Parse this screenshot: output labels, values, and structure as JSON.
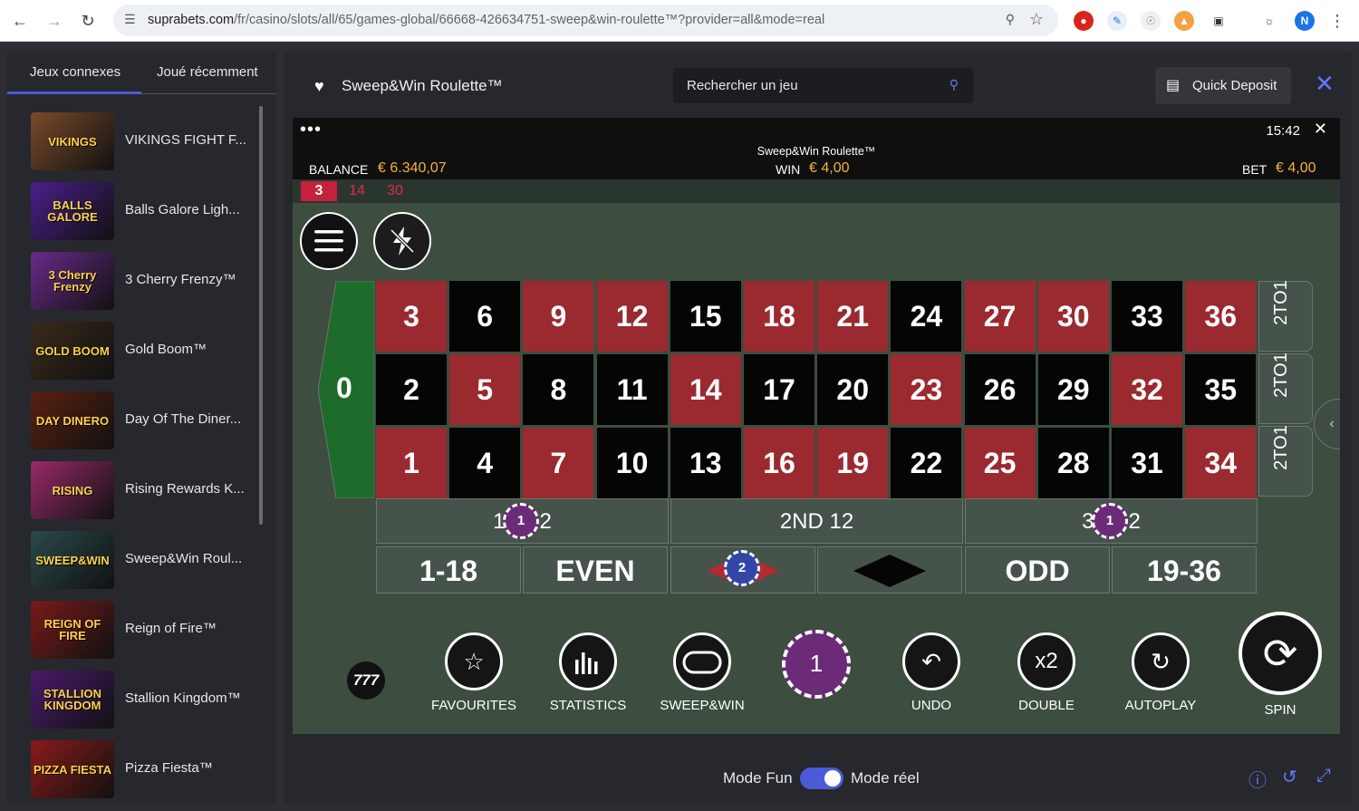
{
  "browser": {
    "url_host": "suprabets.com",
    "url_path": "/fr/casino/slots/all/65/games-global/66668-426634751-sweep&win-roulette™?provider=all&mode=real",
    "profile_initial": "N"
  },
  "sidebar": {
    "tabs": [
      "Jeux connexes",
      "Joué récemment"
    ],
    "games": [
      {
        "name": "VIKINGS FIGHT F...",
        "thumb": "VIKINGS",
        "color": "#7a4a2a"
      },
      {
        "name": "Balls Galore Ligh...",
        "thumb": "BALLS GALORE",
        "color": "#4a1f8a"
      },
      {
        "name": "3 Cherry Frenzy™",
        "thumb": "3 Cherry Frenzy",
        "color": "#6a2a8a"
      },
      {
        "name": "Gold Boom™",
        "thumb": "GOLD BOOM",
        "color": "#3a2a1a"
      },
      {
        "name": "Day Of The Diner...",
        "thumb": "DAY DINERO",
        "color": "#5a2010"
      },
      {
        "name": "Rising Rewards K...",
        "thumb": "RISING",
        "color": "#9a2a6a"
      },
      {
        "name": "Sweep&Win Roul...",
        "thumb": "SWEEP&WIN",
        "color": "#2a4a4a"
      },
      {
        "name": "Reign of Fire™",
        "thumb": "REIGN OF FIRE",
        "color": "#7a1a1a"
      },
      {
        "name": "Stallion Kingdom™",
        "thumb": "STALLION KINGDOM",
        "color": "#4a1a6a"
      },
      {
        "name": "Pizza Fiesta™",
        "thumb": "PIZZA FIESTA",
        "color": "#8a1a1a"
      }
    ]
  },
  "header": {
    "title": "Sweep&Win Roulette™",
    "search_placeholder": "Rechercher un jeu",
    "quick_deposit": "Quick Deposit"
  },
  "game": {
    "time": "15:42",
    "title": "Sweep&Win Roulette™",
    "balance_label": "BALANCE",
    "balance_value": "€ 6.340,07",
    "win_label": "WIN",
    "win_value": "€ 4,00",
    "bet_label": "BET",
    "bet_value": "€ 4,00",
    "history": [
      "3",
      "14",
      "30"
    ],
    "zero": "0",
    "rows": [
      [
        {
          "n": "3",
          "c": "red"
        },
        {
          "n": "6",
          "c": "black"
        },
        {
          "n": "9",
          "c": "red"
        },
        {
          "n": "12",
          "c": "red"
        },
        {
          "n": "15",
          "c": "black"
        },
        {
          "n": "18",
          "c": "red"
        },
        {
          "n": "21",
          "c": "red"
        },
        {
          "n": "24",
          "c": "black"
        },
        {
          "n": "27",
          "c": "red"
        },
        {
          "n": "30",
          "c": "red"
        },
        {
          "n": "33",
          "c": "black"
        },
        {
          "n": "36",
          "c": "red"
        }
      ],
      [
        {
          "n": "2",
          "c": "black"
        },
        {
          "n": "5",
          "c": "red"
        },
        {
          "n": "8",
          "c": "black"
        },
        {
          "n": "11",
          "c": "black"
        },
        {
          "n": "14",
          "c": "red"
        },
        {
          "n": "17",
          "c": "black"
        },
        {
          "n": "20",
          "c": "black"
        },
        {
          "n": "23",
          "c": "red"
        },
        {
          "n": "26",
          "c": "black"
        },
        {
          "n": "29",
          "c": "black"
        },
        {
          "n": "32",
          "c": "red"
        },
        {
          "n": "35",
          "c": "black"
        }
      ],
      [
        {
          "n": "1",
          "c": "red"
        },
        {
          "n": "4",
          "c": "black"
        },
        {
          "n": "7",
          "c": "red"
        },
        {
          "n": "10",
          "c": "black"
        },
        {
          "n": "13",
          "c": "black"
        },
        {
          "n": "16",
          "c": "red"
        },
        {
          "n": "19",
          "c": "red"
        },
        {
          "n": "22",
          "c": "black"
        },
        {
          "n": "25",
          "c": "red"
        },
        {
          "n": "28",
          "c": "black"
        },
        {
          "n": "31",
          "c": "black"
        },
        {
          "n": "34",
          "c": "red"
        }
      ]
    ],
    "column_label": "2TO1",
    "dozen_1": "1",
    "dozen_1b": "2",
    "dozen_2": "2ND 12",
    "dozen_3": "3",
    "dozen_3b": "2",
    "outside": [
      "1-18",
      "EVEN",
      "",
      "",
      "ODD",
      "19-36"
    ],
    "chip_dozen": "1",
    "chip_red": "2",
    "chip_selected": "1",
    "controls": [
      "FAVOURITES",
      "STATISTICS",
      "SWEEP&WIN",
      "UNDO",
      "DOUBLE",
      "AUTOPLAY",
      "SPIN"
    ],
    "double_label": "x2",
    "logo_777": "777"
  },
  "footer": {
    "mode_fun": "Mode Fun",
    "mode_real": "Mode réel",
    "toggle_on": true
  }
}
